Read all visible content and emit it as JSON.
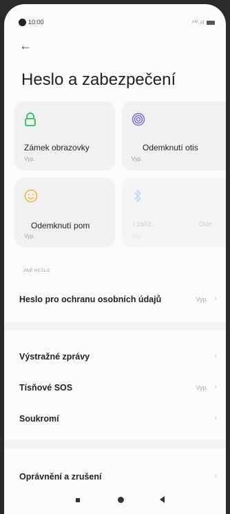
{
  "status_bar": {
    "time": "10:00",
    "signal": "⁴ᴳ.ıl"
  },
  "page": {
    "title": "Heslo a zabezpečení"
  },
  "tiles": [
    {
      "label": "Zámek obrazovky",
      "status": "Vyp.",
      "icon": "lock-icon",
      "color": "#2bbf5a"
    },
    {
      "label": "Odemknutí otis",
      "status": "Vyp.",
      "icon": "fingerprint-icon",
      "color": "#7a6cd8"
    },
    {
      "label": "Odemknutí pom",
      "status": "Vyp.",
      "icon": "face-icon",
      "color": "#f0b83a"
    },
    {
      "label": "ı zaříz.",
      "label2": "Ode",
      "status": "Vyp.",
      "icon": "bluetooth-icon",
      "color": "#8cc4f0"
    }
  ],
  "section": {
    "other_password": "JINÉ HESLO"
  },
  "rows": {
    "privacy_password": {
      "label": "Heslo pro ochranu osobních údajů",
      "value": "Vyp."
    },
    "alerts": {
      "label": "Výstražné zprávy"
    },
    "sos": {
      "label": "Tísňové SOS",
      "value": "Vyp."
    },
    "privacy": {
      "label": "Soukromí"
    },
    "permissions": {
      "label": "Oprávnění a zrušení"
    }
  },
  "chevron": "›"
}
